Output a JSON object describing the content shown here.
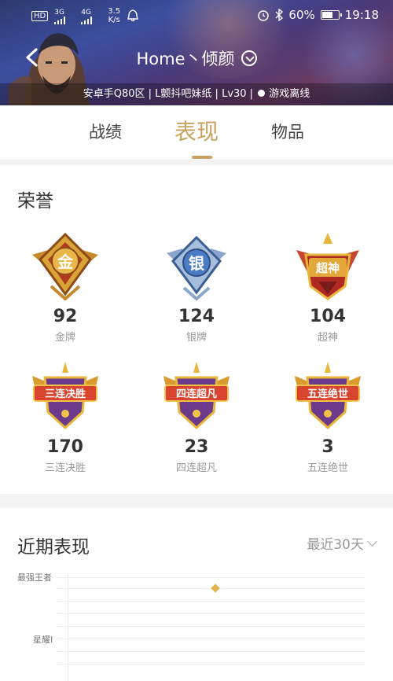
{
  "status_bar": {
    "network_left": "HD",
    "net_3g": "3G",
    "net_4g": "4G",
    "speed_value": "3.5",
    "speed_unit": "K/s",
    "battery": "60%",
    "time": "19:18"
  },
  "nav": {
    "title": "Home丶倾颜"
  },
  "info_bar": {
    "text_prefix": "安卓手Q80区 | L颤抖吧妹纸 | Lv30 |",
    "status": "游戏离线"
  },
  "tabs": [
    {
      "label": "战绩"
    },
    {
      "label": "表现"
    },
    {
      "label": "物品"
    }
  ],
  "honor": {
    "title": "荣誉",
    "badges": [
      {
        "count": "92",
        "name": "金牌",
        "icon_text": "金",
        "icon": "gold-medal-icon"
      },
      {
        "count": "124",
        "name": "银牌",
        "icon_text": "银",
        "icon": "silver-medal-icon"
      },
      {
        "count": "104",
        "name": "超神",
        "icon_text": "超神",
        "icon": "legendary-badge-icon"
      },
      {
        "count": "170",
        "name": "三连决胜",
        "icon_text": "三连决胜",
        "icon": "triple-kill-badge-icon"
      },
      {
        "count": "23",
        "name": "四连超凡",
        "icon_text": "四连超凡",
        "icon": "quadra-kill-badge-icon"
      },
      {
        "count": "3",
        "name": "五连绝世",
        "icon_text": "五连绝世",
        "icon": "penta-kill-badge-icon"
      }
    ]
  },
  "recent": {
    "title": "近期表现",
    "filter_label": "最近30天",
    "rank_labels": [
      "最强王者",
      "星耀I"
    ]
  },
  "colors": {
    "accent": "#c8a25c",
    "point": "#e0b24a"
  }
}
